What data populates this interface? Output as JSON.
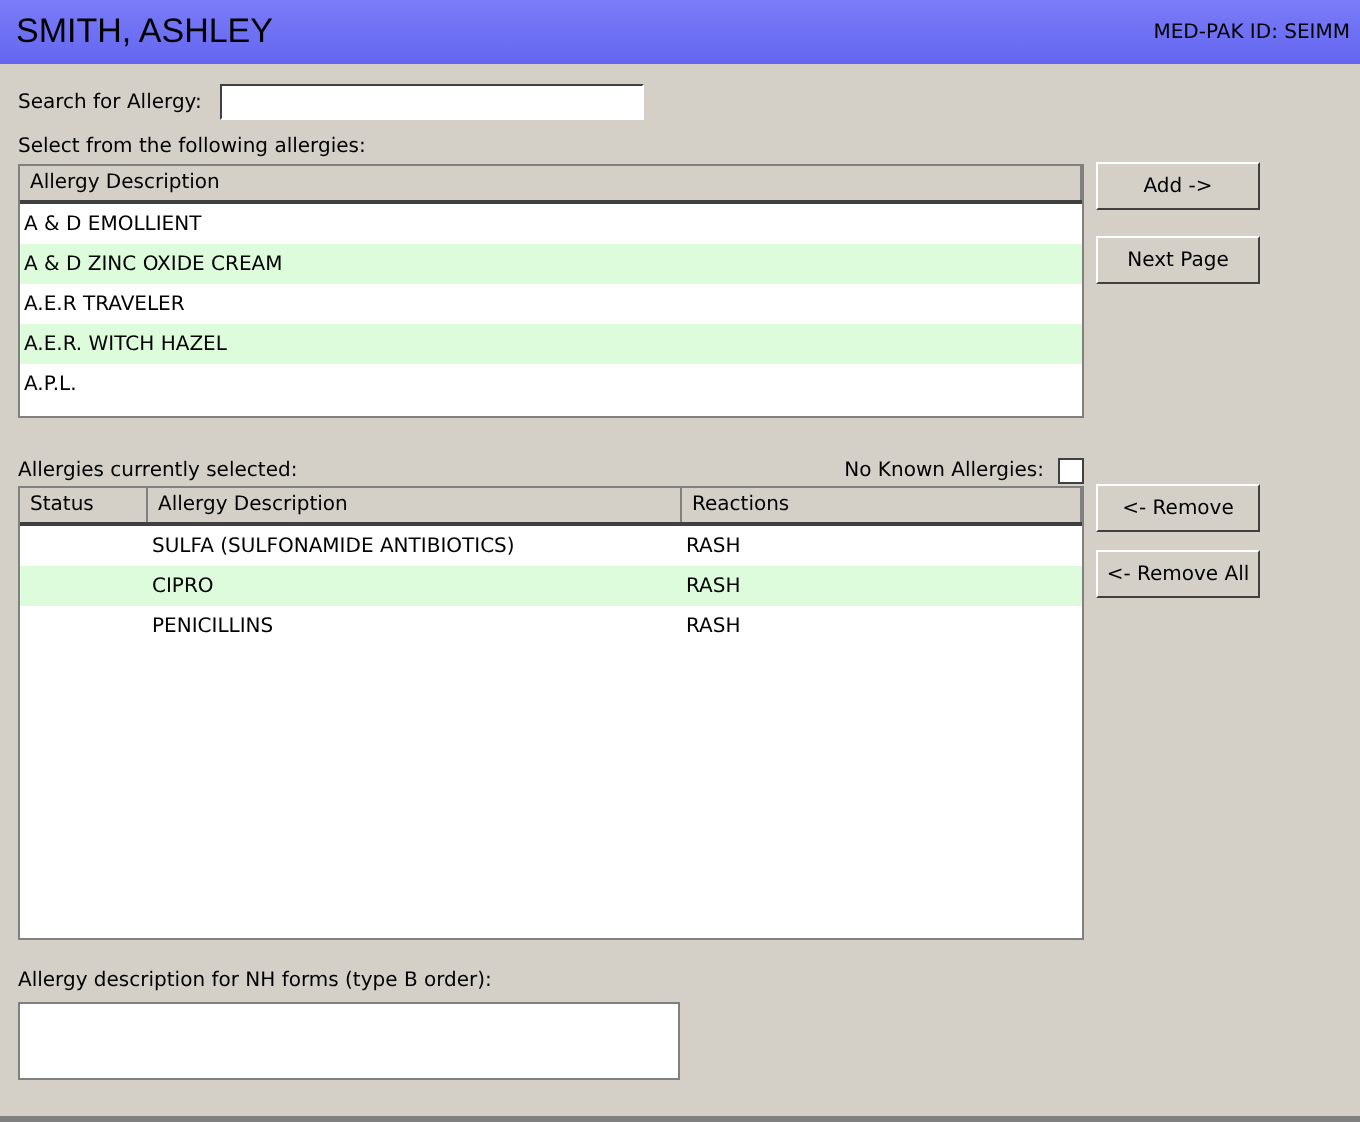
{
  "header": {
    "patient_name": "SMITH, ASHLEY",
    "med_pak_id": "MED-PAK ID: SEIMM"
  },
  "search": {
    "label": "Search for Allergy:"
  },
  "available": {
    "label": "Select from the following allergies:",
    "column": "Allergy Description",
    "rows": [
      "A & D EMOLLIENT",
      "A & D ZINC OXIDE CREAM",
      "A.E.R TRAVELER",
      "A.E.R. WITCH HAZEL",
      "A.P.L."
    ]
  },
  "available_buttons": [
    "Add ->",
    "Next Page"
  ],
  "current": {
    "label": "Allergies currently selected:",
    "no_known": {
      "label": "No Known Allergies:",
      "checked": false
    },
    "columns": [
      "Status",
      "Allergy Description",
      "Reactions"
    ],
    "rows": [
      {
        "description": "SULFA (SULFONAMIDE ANTIBIOTICS)",
        "reaction": "RASH"
      },
      {
        "description": "CIPRO",
        "reaction": "RASH"
      },
      {
        "description": "PENICILLINS",
        "reaction": "RASH"
      }
    ]
  },
  "current_buttons": [
    "<- Remove",
    "<- Remove All"
  ],
  "nh_forms": {
    "label": "Allergy description for NH forms (type B order):"
  }
}
